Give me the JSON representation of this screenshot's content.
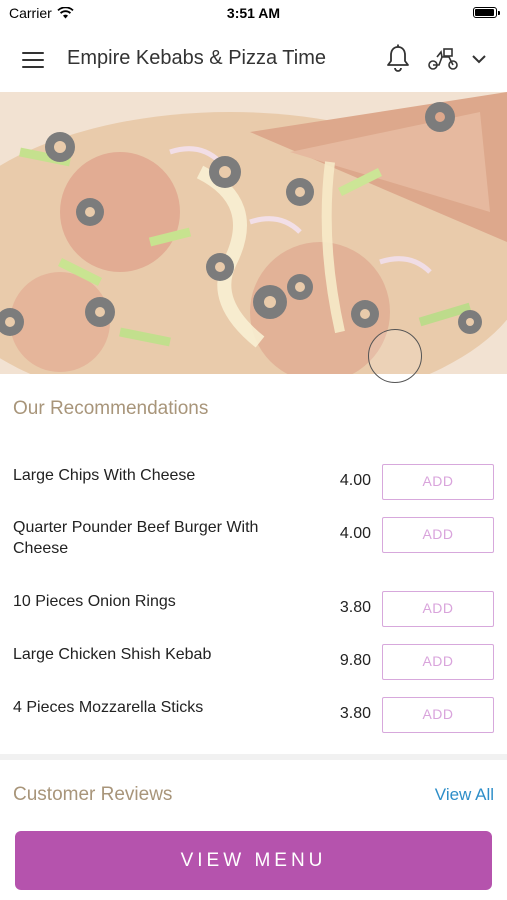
{
  "status_bar": {
    "carrier": "Carrier",
    "time": "3:51 AM",
    "battery_level": 1.0
  },
  "header": {
    "title": "Empire Kebabs & Pizza Time",
    "icons": [
      "menu-icon",
      "bell-icon",
      "scooter-icon",
      "chevron-down-icon"
    ]
  },
  "hero": {
    "image": "pizza slice photo",
    "carousel_indicator": "circle"
  },
  "recommendations": {
    "heading": "Our Recommendations",
    "items": [
      {
        "name": "Large Chips With Cheese",
        "price": "4.00",
        "button": "ADD"
      },
      {
        "name": "Quarter Pounder Beef Burger With Cheese",
        "price": "4.00",
        "button": "ADD"
      },
      {
        "name": "10 Pieces Onion Rings",
        "price": "3.80",
        "button": "ADD"
      },
      {
        "name": "Large Chicken Shish Kebab",
        "price": "9.80",
        "button": "ADD"
      },
      {
        "name": "4 Pieces Mozzarella Sticks",
        "price": "3.80",
        "button": "ADD"
      }
    ]
  },
  "reviews": {
    "heading": "Customer Reviews",
    "view_all": "View All"
  },
  "footer": {
    "view_menu": "VIEW MENU"
  },
  "colors": {
    "accent_purple": "#b553ad",
    "add_border": "#d7a8dc",
    "section_heading": "#a8957a",
    "link_blue": "#2e8ec8"
  }
}
